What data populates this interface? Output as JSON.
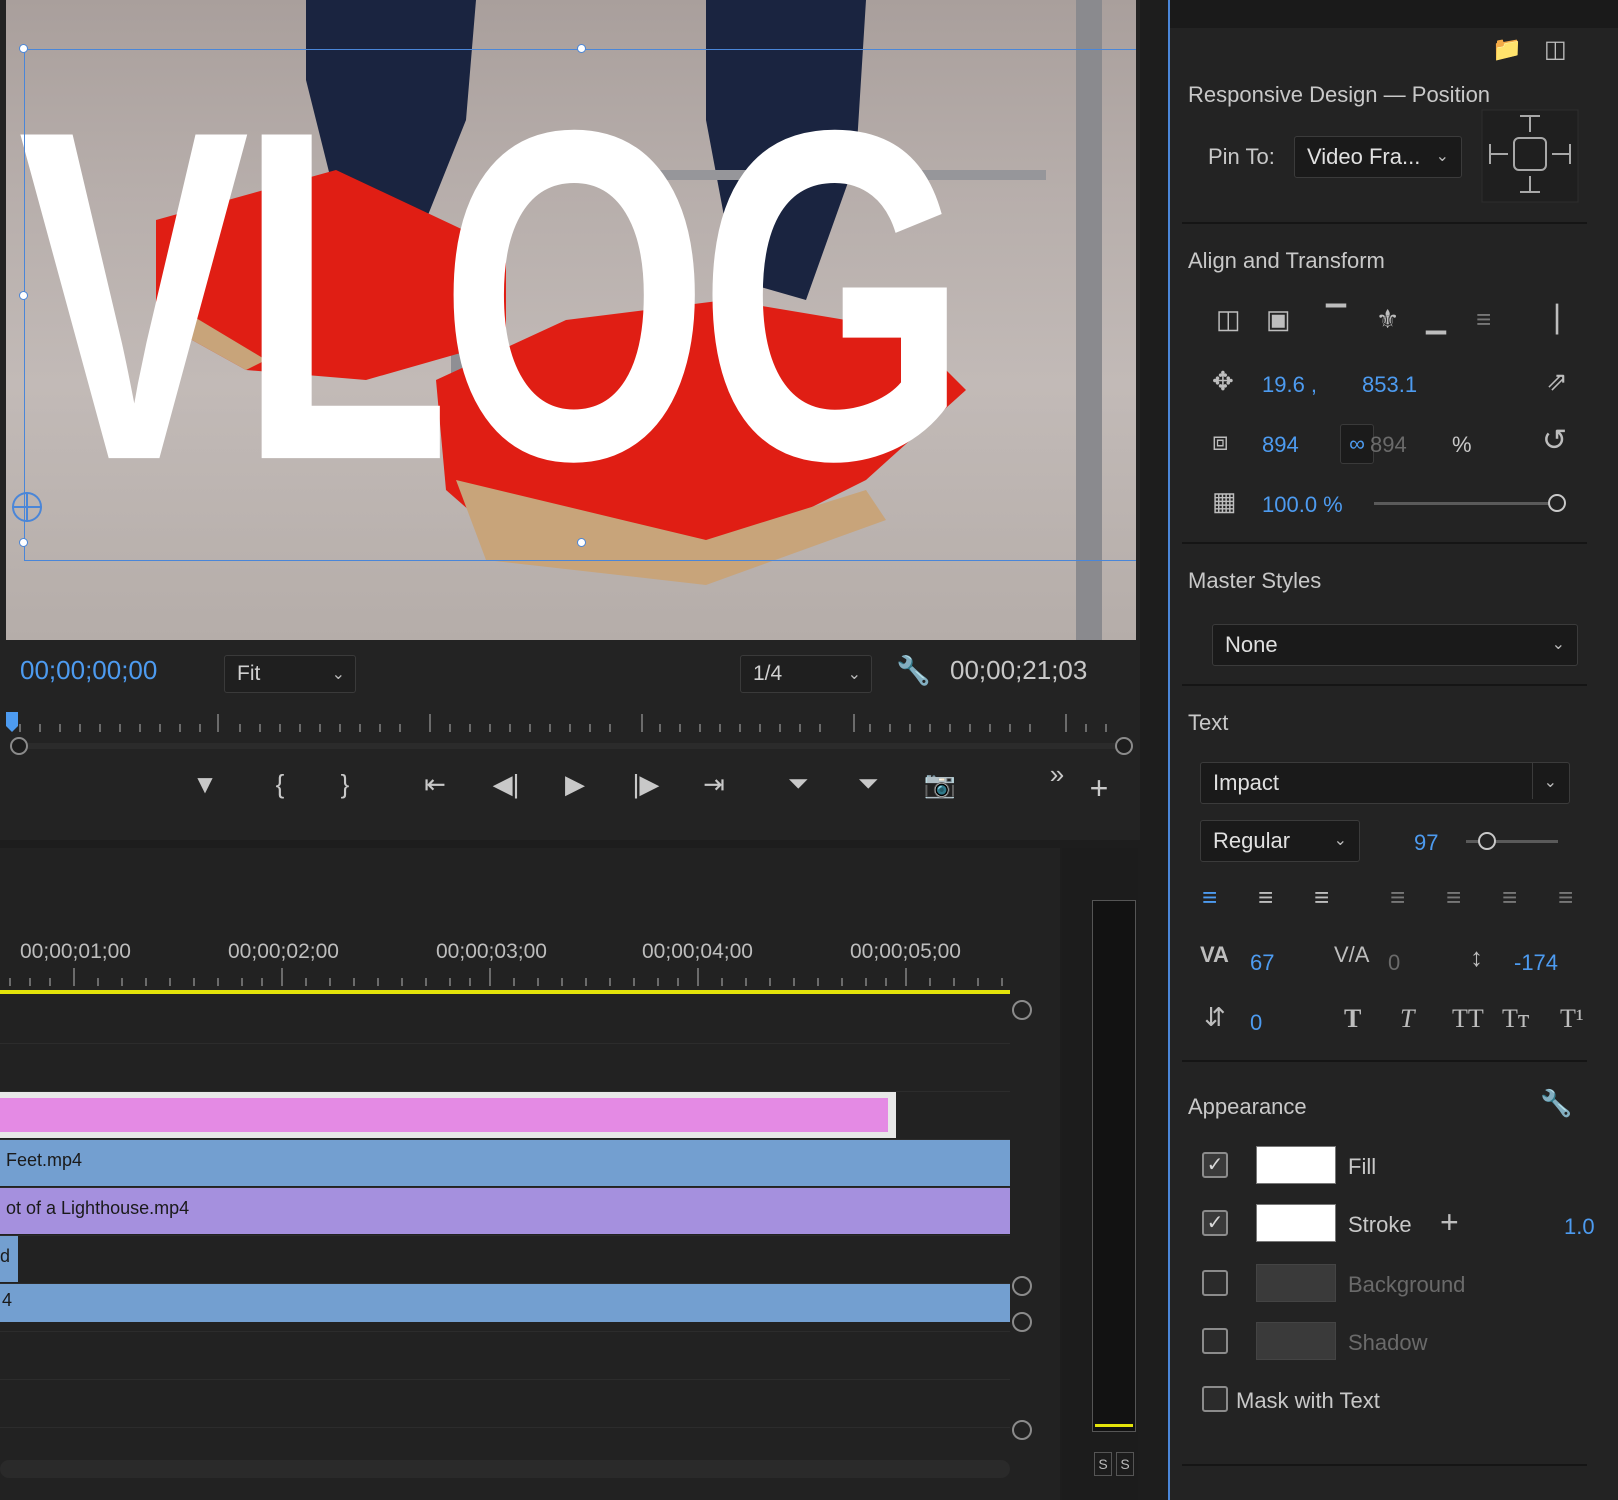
{
  "monitor": {
    "title_text": "VLOG",
    "timecode_current": "00;00;00;00",
    "zoom_select": "Fit",
    "resolution_select": "1/4",
    "timecode_duration": "00;00;21;03"
  },
  "transport": {
    "marker_icon": "marker-icon",
    "mark_in_icon": "mark-in-icon",
    "mark_out_icon": "mark-out-icon",
    "go_to_in_icon": "go-to-in-icon",
    "step_back_icon": "step-back-icon",
    "play_icon": "play-icon",
    "step_forward_icon": "step-forward-icon",
    "go_to_out_icon": "go-to-out-icon",
    "lift_icon": "lift-icon",
    "extract_icon": "extract-icon",
    "export_frame_icon": "camera-icon",
    "more_icon": "overflow-icon",
    "add_icon": "plus-icon"
  },
  "timeline": {
    "ruler_labels": [
      "00;00;01;00",
      "00;00;02;00",
      "00;00;03;00",
      "00;00;04;00",
      "00;00;05;00"
    ],
    "clips": [
      {
        "label": "",
        "color": "#e48ae4"
      },
      {
        "label": "Feet.mp4",
        "color": "#739fd0"
      },
      {
        "label": "ot of a Lighthouse.mp4",
        "color": "#a590de"
      },
      {
        "label": "d",
        "color": "#739fd0"
      },
      {
        "label": "4",
        "color": "#739fd0"
      }
    ]
  },
  "meter": {
    "solo_left": "S",
    "solo_right": "S"
  },
  "egp": {
    "responsive_title": "Responsive Design — Position",
    "pin_to_label": "Pin To:",
    "pin_to_value": "Video Fra...",
    "align_title": "Align and Transform",
    "position_x": "19.6 ,",
    "position_y": "853.1",
    "scale_w": "894",
    "scale_h": "894",
    "scale_unit": "%",
    "opacity": "100.0 %",
    "master_styles_title": "Master Styles",
    "master_styles_value": "None",
    "text_title": "Text",
    "font_family": "Impact",
    "font_style": "Regular",
    "font_size": "97",
    "kerning": "67",
    "tracking": "0",
    "leading": "-174",
    "baseline": "0",
    "appearance_title": "Appearance",
    "fill_label": "Fill",
    "stroke_label": "Stroke",
    "stroke_width": "1.0",
    "background_label": "Background",
    "shadow_label": "Shadow",
    "mask_label": "Mask with Text",
    "accent_color": "#4d9bf0"
  }
}
